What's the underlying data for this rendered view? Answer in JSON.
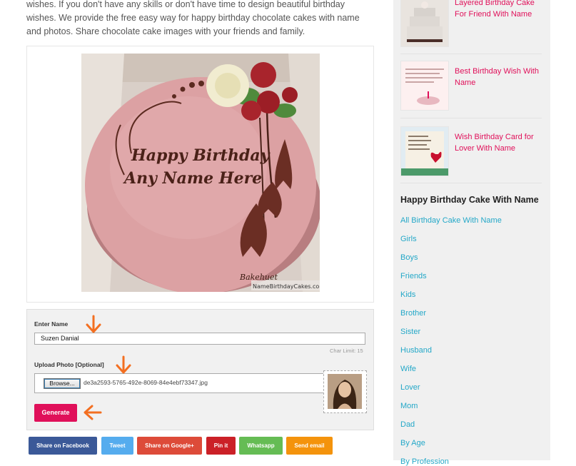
{
  "intro": {
    "text": "wishes. If you don't have any skills or don't have time to design beautiful birthday wishes. We provide the free easy way for happy birthday chocolate cakes with name and photos. Share chocolate cake images with your friends and family."
  },
  "cake": {
    "line1": "Happy Birthday",
    "line2": "Any Name Here",
    "signature": "Bakehuet",
    "watermark": "NameBirthdayCakes.com"
  },
  "form": {
    "name_label": "Enter Name",
    "name_value": "Suzen Danial",
    "char_limit": "Char Limit: 15",
    "upload_label": "Upload Photo [Optional]",
    "browse_label": "Browse...",
    "file_name": "de3a2593-5765-492e-8069-84e4ebf73347.jpg",
    "generate_label": "Generate"
  },
  "share": {
    "facebook": "Share on Facebook",
    "tweet": "Tweet",
    "google": "Share on Google+",
    "pin": "Pin it",
    "whatsapp": "Whatsapp",
    "email": "Send email"
  },
  "sidebar": {
    "posts": [
      {
        "title": "Layered Birthday Cake For Friend With Name"
      },
      {
        "title": "Best Birthday Wish With Name"
      },
      {
        "title": "Wish Birthday Card for Lover With Name"
      }
    ],
    "widget_title": "Happy Birthday Cake With Name",
    "categories": [
      "All Birthday Cake With Name",
      "Girls",
      "Boys",
      "Friends",
      "Kids",
      "Brother",
      "Sister",
      "Husband",
      "Wife",
      "Lover",
      "Mom",
      "Dad",
      "By Age",
      "By Profession"
    ]
  },
  "colors": {
    "accent": "#e0105a",
    "link": "#24a8c8",
    "arrow": "#f36f21",
    "facebook": "#3b5998",
    "twitter": "#55acee",
    "google": "#dd4b39",
    "pinterest": "#cb2027",
    "whatsapp": "#65bc54",
    "email": "#f4930c"
  }
}
